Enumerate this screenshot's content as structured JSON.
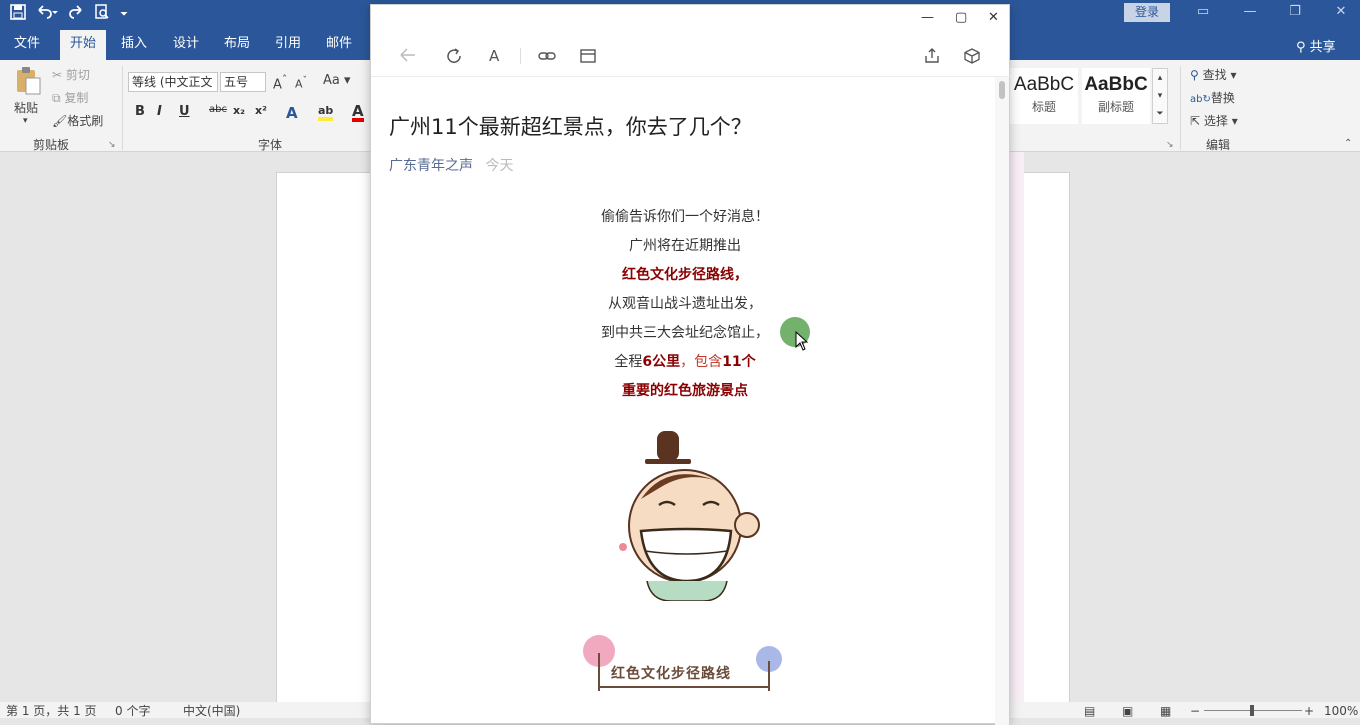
{
  "word": {
    "login_label": "登录",
    "share_label": "共享",
    "tabs": [
      {
        "label": "文件"
      },
      {
        "label": "开始"
      },
      {
        "label": "插入"
      },
      {
        "label": "设计"
      },
      {
        "label": "布局"
      },
      {
        "label": "引用"
      },
      {
        "label": "邮件"
      }
    ],
    "clipboard": {
      "paste_label": "粘贴",
      "cut_label": "剪切",
      "copy_label": "复制",
      "format_painter_label": "格式刷",
      "group_label": "剪贴板"
    },
    "font": {
      "font_name": "等线 (中文正文",
      "font_size": "五号",
      "change_case": "Aa",
      "group_label": "字体"
    },
    "styles": {
      "items": [
        {
          "preview": "AaBbC",
          "name": "标题"
        },
        {
          "preview": "AaBbC",
          "name": "副标题"
        }
      ]
    },
    "editing": {
      "find_label": "查找",
      "replace_label": "替换",
      "select_label": "选择",
      "group_label": "编辑"
    },
    "status": {
      "page": "第 1 页，共 1 页",
      "words": "0 个字",
      "language": "中文(中国)",
      "zoom": "100%"
    }
  },
  "article": {
    "title": "广州11个最新超红景点，你去了几个？",
    "source": "广东青年之声",
    "date": "今天",
    "lines": [
      {
        "text": "偷偷告诉你们一个好消息！"
      },
      {
        "text": "广州将在近期推出"
      },
      {
        "text": "红色文化步径路线，"
      },
      {
        "text": "从观音山战斗遗址出发，"
      },
      {
        "text": "到中共三大会址纪念馆止，"
      },
      {
        "pre": "全程",
        "b1": "6公里",
        "mid": "，包含",
        "b2": "11个"
      },
      {
        "text": "重要的红色旅游景点"
      }
    ],
    "banner_text": "红色文化步径路线"
  }
}
